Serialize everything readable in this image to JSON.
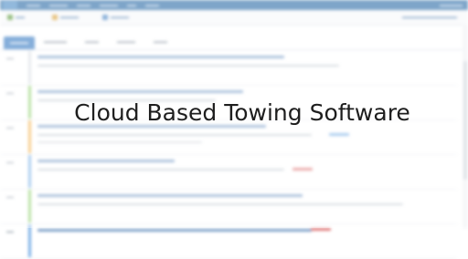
{
  "headline": "Cloud Based Towing Software",
  "colors": {
    "nav_bar": "#2f6ea8",
    "active_tab": "#3b7dc4",
    "headline_text": "#1e1e1e",
    "row_stripes": [
      "#d8dde3",
      "#8fcf6e",
      "#f3b04a",
      "#7ab0e6",
      "#8fcf6e",
      "#7ab0e6"
    ],
    "status_tag": "#e07a7a"
  },
  "icons": [
    "add-call-icon",
    "transfer-icon",
    "message-icon"
  ]
}
